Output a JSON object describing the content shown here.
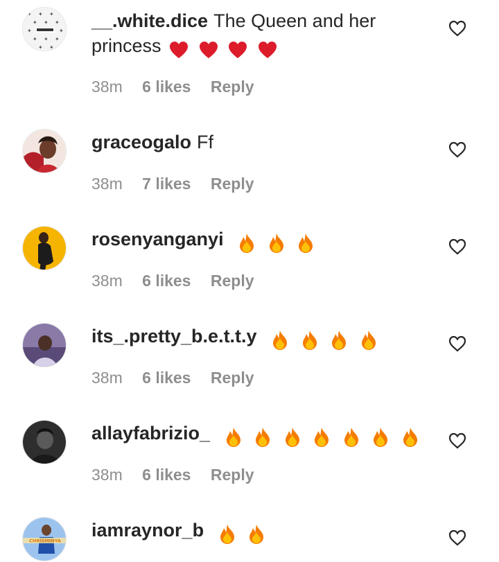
{
  "comments": [
    {
      "username": "__.white.dice",
      "text": "The Queen and her princess",
      "emoji": "heart",
      "emoji_count": 4,
      "time": "38m",
      "likes": "6 likes",
      "reply": "Reply"
    },
    {
      "username": "graceogalo",
      "text": "Ff",
      "emoji": "",
      "emoji_count": 0,
      "time": "38m",
      "likes": "7 likes",
      "reply": "Reply"
    },
    {
      "username": "rosenyanganyi",
      "text": "",
      "emoji": "fire",
      "emoji_count": 3,
      "time": "38m",
      "likes": "6 likes",
      "reply": "Reply"
    },
    {
      "username": "its_.pretty_b.e.t.t.y",
      "text": "",
      "emoji": "fire",
      "emoji_count": 4,
      "time": "38m",
      "likes": "6 likes",
      "reply": "Reply"
    },
    {
      "username": "allayfabrizio_",
      "text": "",
      "emoji": "fire",
      "emoji_count": 7,
      "time": "38m",
      "likes": "6 likes",
      "reply": "Reply"
    },
    {
      "username": "iamraynor_b",
      "text": "",
      "emoji": "fire",
      "emoji_count": 2,
      "time": "",
      "likes": "",
      "reply": ""
    }
  ],
  "avatars": [
    {
      "icon": "monogram-pattern-avatar",
      "bg": "#f2f2f2"
    },
    {
      "icon": "portrait-avatar",
      "bg": "#b3202a"
    },
    {
      "icon": "portrait-avatar",
      "bg": "#f5b400"
    },
    {
      "icon": "portrait-avatar",
      "bg": "#6a5a8a"
    },
    {
      "icon": "portrait-avatar",
      "bg": "#4a4a4a"
    },
    {
      "icon": "portrait-avatar",
      "bg": "#6d9ad0"
    }
  ],
  "avatar_caption_6": "CHRISMINYA"
}
